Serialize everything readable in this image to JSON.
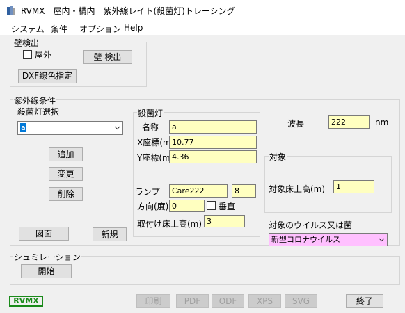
{
  "window": {
    "title": "RVMX　屋内・構内　紫外線レイト(殺菌灯)トレーシング"
  },
  "menu": {
    "items": [
      "システム",
      "条件",
      "オプション",
      "Help"
    ]
  },
  "wall_detect": {
    "group_label": "壁検出",
    "outdoor_label": "屋外",
    "outdoor_checked": false,
    "detect_button": "壁 検出",
    "dxf_button": "DXF線色指定"
  },
  "uv_conditions": {
    "group_label": "紫外線条件",
    "lamp_select_label": "殺菌灯選択",
    "lamp_select_value": "a",
    "add_button": "追加",
    "change_button": "変更",
    "delete_button": "削除",
    "figure_button": "図面",
    "new_button": "新規"
  },
  "lamp": {
    "group_label": "殺菌灯",
    "name_label": "名称",
    "name_value": "a",
    "x_label": "X座標(m)",
    "x_value": "10.77",
    "y_label": "Y座標(m)",
    "y_value": "4.36",
    "lamp_label": "ランプ",
    "lamp_value": "Care222",
    "lamp_count": "8",
    "direction_label": "方向(度)",
    "direction_value": "0",
    "vertical_label": "垂直",
    "vertical_checked": false,
    "mount_label": "取付け床上高(m)",
    "mount_value": "3"
  },
  "wavelength": {
    "label": "波長",
    "value": "222",
    "unit": "nm"
  },
  "target": {
    "group_label": "対象",
    "floor_height_label": "対象床上高(m)",
    "floor_height_value": "1",
    "virus_label": "対象のウイルス又は菌",
    "virus_value": "新型コロナウイルス"
  },
  "simulation": {
    "group_label": "シュミレーション",
    "start_button": "開始"
  },
  "footer": {
    "logo_text": "RVMX",
    "print_button": "印刷",
    "pdf_button": "PDF",
    "odf_button": "ODF",
    "xps_button": "XPS",
    "svg_button": "SVG",
    "exit_button": "終了"
  },
  "colors": {
    "input_bg": "#ffffc0",
    "virus_combo_bg": "#ffc0ff",
    "selection": "#0078d7",
    "logo_green": "#1a8a1a"
  }
}
